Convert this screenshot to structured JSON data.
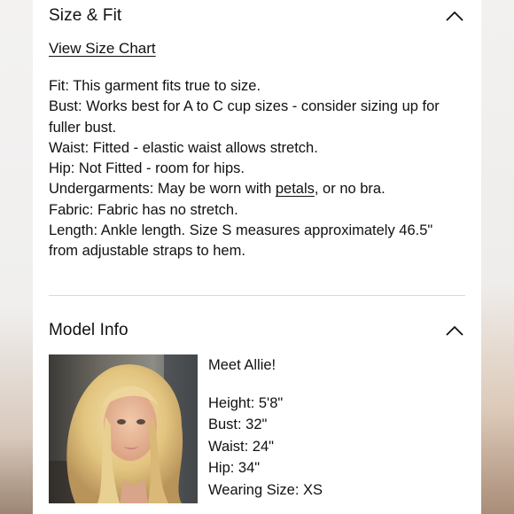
{
  "size_fit": {
    "title": "Size & Fit",
    "size_chart_link": "View Size Chart",
    "lines": {
      "fit": "Fit: This garment fits true to size.",
      "bust": "Bust: Works best for A to C cup sizes - consider sizing up for fuller bust.",
      "waist": "Waist: Fitted - elastic waist allows stretch.",
      "hip": "Hip: Not Fitted - room for hips.",
      "undergarments_before": "Undergarments: May be worn with ",
      "undergarments_link": "petals",
      "undergarments_after": ", or no bra.",
      "fabric": "Fabric: Fabric has no stretch.",
      "length": "Length: Ankle length. Size S measures approximately 46.5\" from adjustable straps to hem."
    }
  },
  "model_info": {
    "title": "Model Info",
    "greeting": "Meet Allie!",
    "height": "Height: 5'8\"",
    "bust": "Bust: 32\"",
    "waist": "Waist: 24\"",
    "hip": "Hip: 34\"",
    "wearing_size": "Wearing Size: XS"
  },
  "icons": {
    "collapse": "chevron-up-icon"
  }
}
